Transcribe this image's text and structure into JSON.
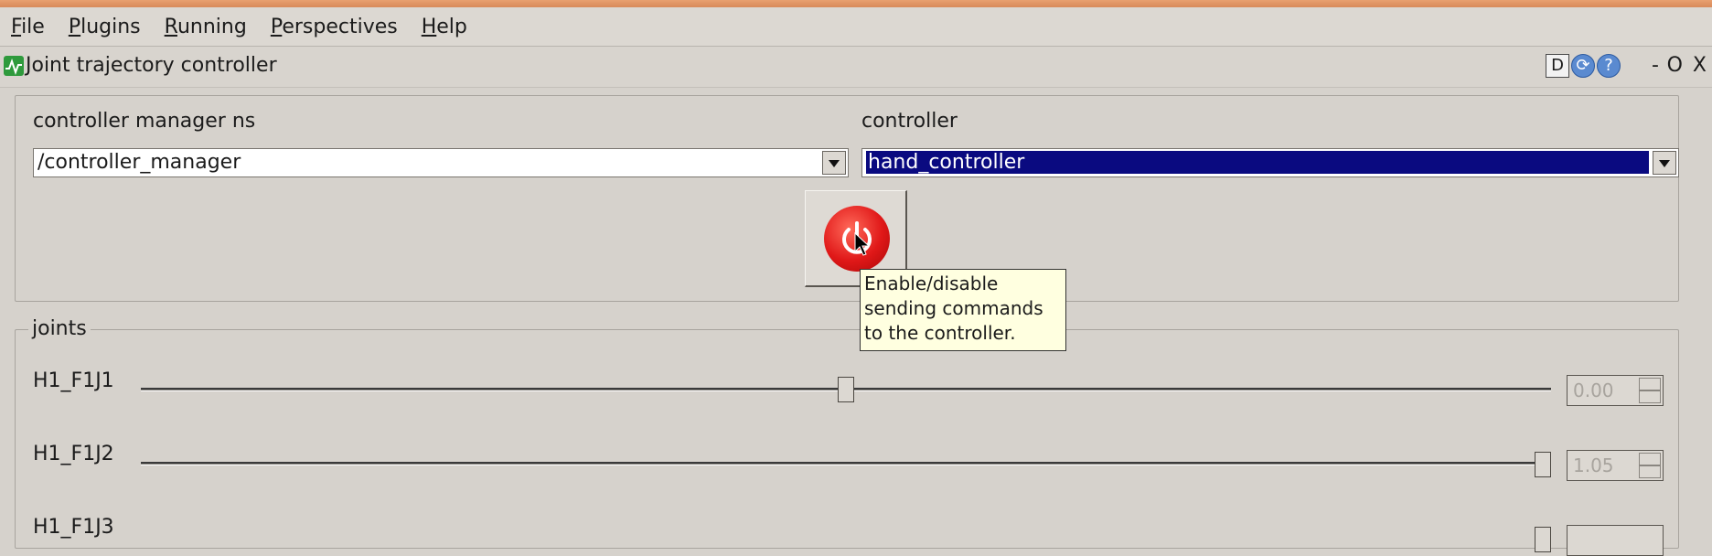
{
  "menubar": {
    "items": [
      "File",
      "Plugins",
      "Running",
      "Perspectives",
      "Help"
    ]
  },
  "plugin": {
    "title": "Joint trajectory controller",
    "header_buttons": [
      "D",
      "reload-icon",
      "help-icon"
    ],
    "window_controls": [
      "-",
      "O",
      "X"
    ]
  },
  "controller_panel": {
    "ns_label": "controller manager ns",
    "ns_value": "/controller_manager",
    "controller_label": "controller",
    "controller_value": "hand_controller",
    "power_icon": "power-icon",
    "power_color": "#e01818",
    "tooltip": [
      "Enable/disable",
      "sending commands",
      "to the controller."
    ]
  },
  "joints": {
    "legend": "joints",
    "items": [
      {
        "name": "H1_F1J1",
        "value": "0.00",
        "position_fraction": 0.5
      },
      {
        "name": "H1_F1J2",
        "value": "1.05",
        "position_fraction": 1.0
      },
      {
        "name": "H1_F1J3",
        "value": "",
        "position_fraction": 1.0
      }
    ]
  }
}
